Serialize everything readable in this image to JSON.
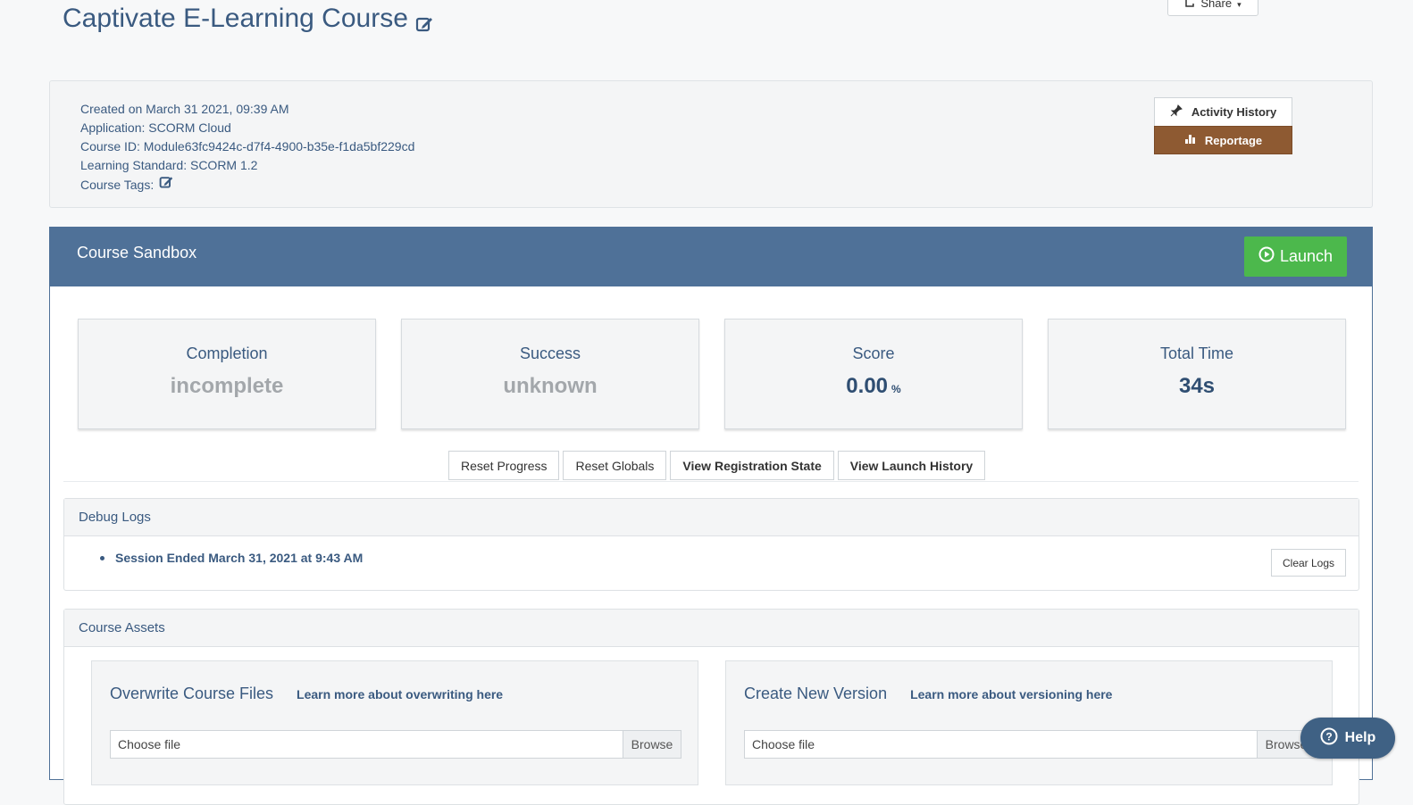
{
  "page": {
    "title": "Captivate E-Learning Course",
    "share_label": "Share"
  },
  "info": {
    "created": "Created on March 31 2021, 09:39 AM",
    "application": "Application: SCORM Cloud",
    "course_id": "Course ID: Module63fc9424c-d7f4-4900-b35e-f1da5bf229cd",
    "standard": "Learning Standard: SCORM 1.2",
    "tags_label": "Course Tags:"
  },
  "side_buttons": {
    "activity_history": "Activity History",
    "reportage": "Reportage"
  },
  "sandbox": {
    "title": "Course Sandbox",
    "launch_label": "Launch",
    "stats": {
      "completion_label": "Completion",
      "completion_value": "incomplete",
      "success_label": "Success",
      "success_value": "unknown",
      "score_label": "Score",
      "score_value": "0.00",
      "score_unit": "%",
      "time_label": "Total Time",
      "time_value": "34s"
    },
    "actions": {
      "reset_progress": "Reset Progress",
      "reset_globals": "Reset Globals",
      "view_registration": "View Registration State",
      "view_launch_history": "View Launch History"
    }
  },
  "debug_logs": {
    "heading": "Debug Logs",
    "entries": [
      "Session Ended March 31, 2021 at 9:43 AM"
    ],
    "clear_label": "Clear Logs"
  },
  "course_assets": {
    "heading": "Course Assets",
    "overwrite": {
      "title": "Overwrite Course Files",
      "link": "Learn more about overwriting here",
      "placeholder": "Choose file",
      "browse": "Browse"
    },
    "new_version": {
      "title": "Create New Version",
      "link": "Learn more about versioning here",
      "placeholder": "Choose file",
      "browse": "Browse"
    }
  },
  "help": {
    "label": "Help"
  },
  "colors": {
    "header_blue": "#4f7198",
    "launch_green": "#4cb84c",
    "reportage_brown": "#8e5a32",
    "help_blue": "#3f6184"
  }
}
